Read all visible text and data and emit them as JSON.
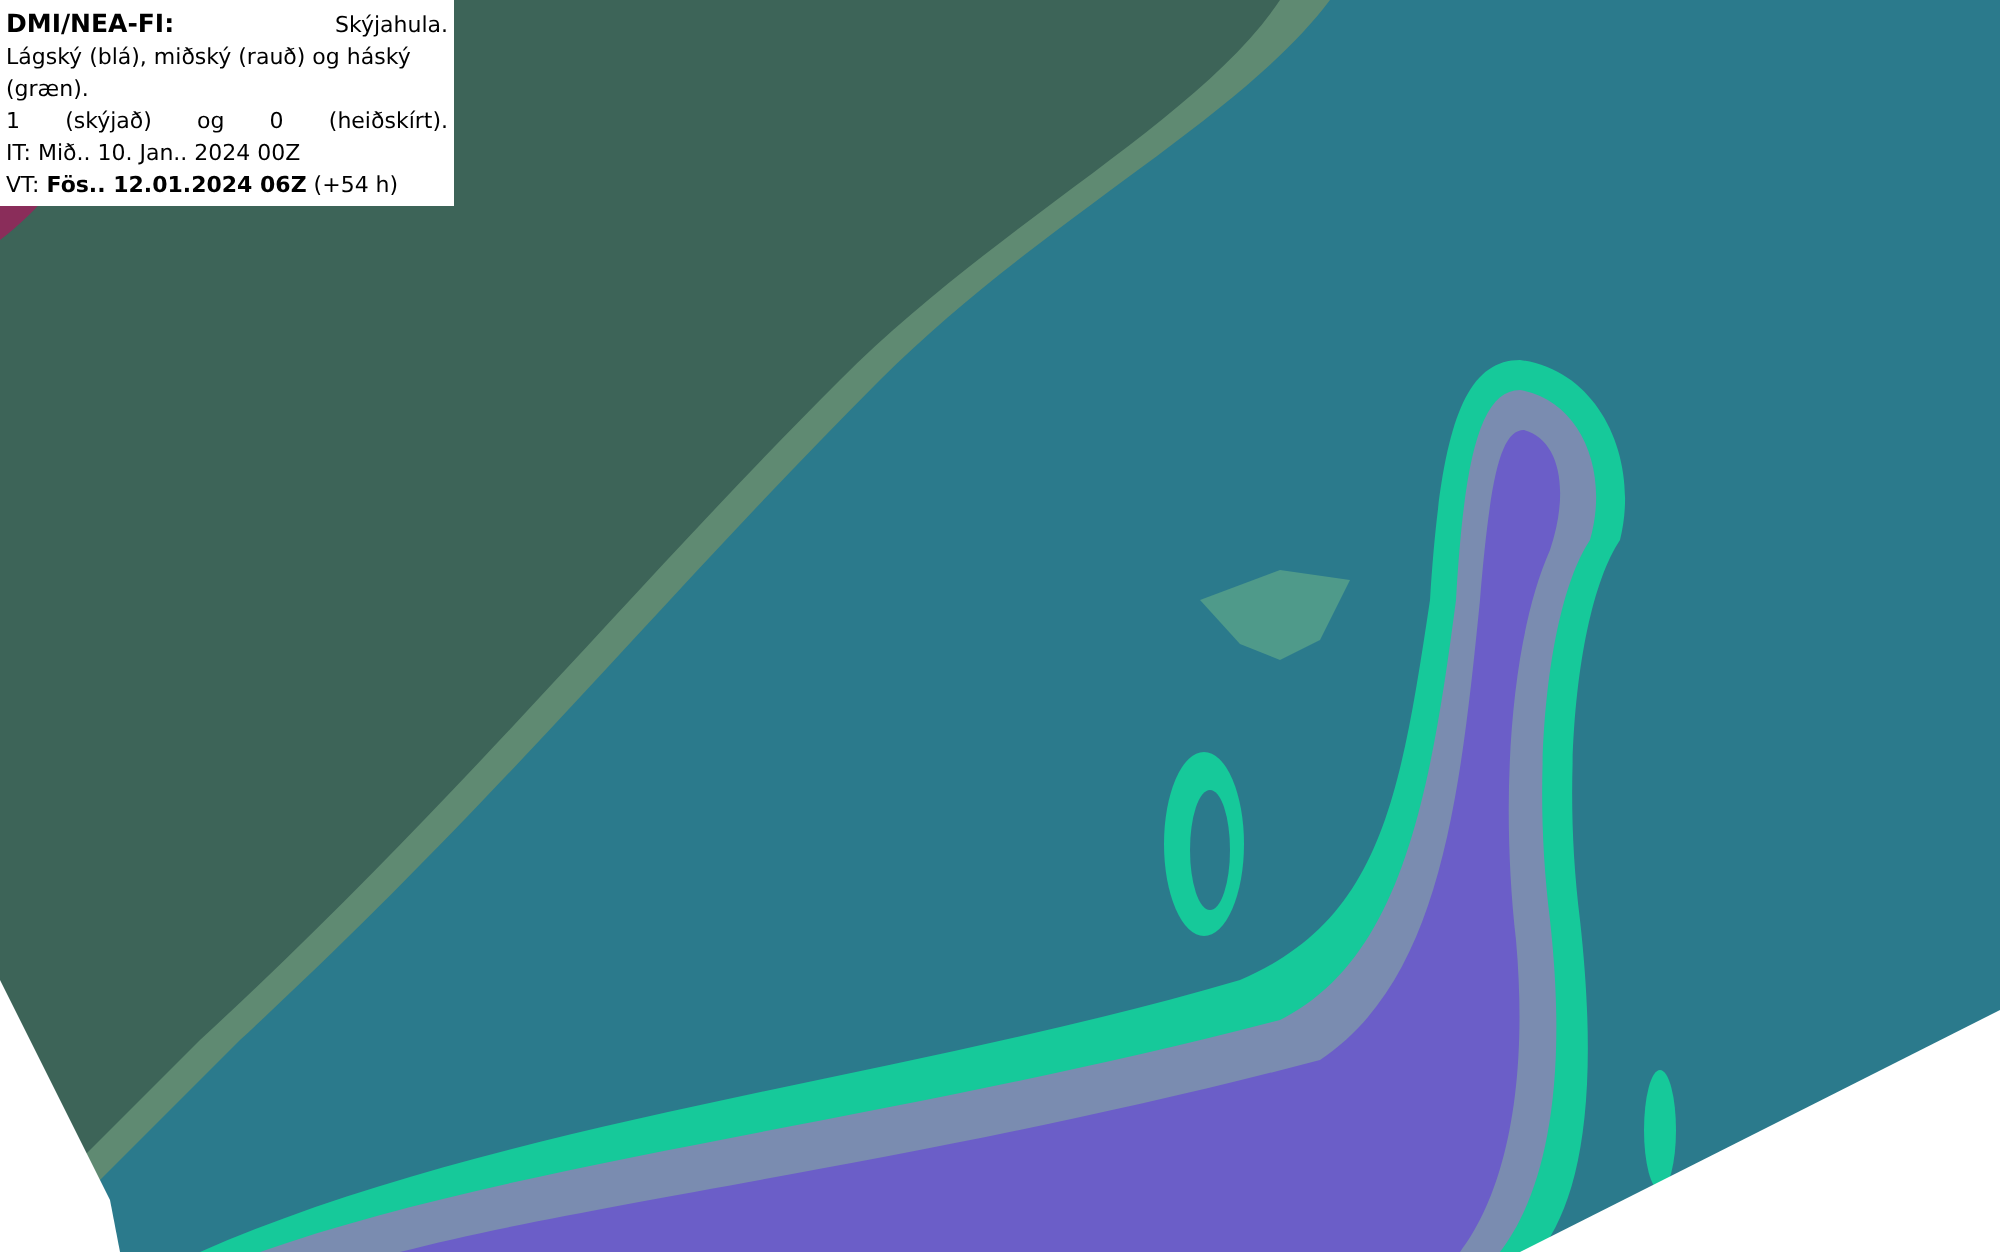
{
  "legend": {
    "title": "DMI/NEA-FI:",
    "subject": "Skýjahula.",
    "lines": [
      {
        "kind": "plain",
        "text": "Lágský (blá), miðský (rauð) og háský (græn)."
      },
      {
        "kind": "justified",
        "text": "1 (skýjað) og 0 (heiðskírt)."
      },
      {
        "kind": "plain",
        "text": "IT: Mið.. 10. Jan.. 2024 00Z"
      },
      {
        "kind": "plain",
        "text": "VT: **Fös.. 12.01.2024 06Z** (+54 h)"
      }
    ]
  }
}
